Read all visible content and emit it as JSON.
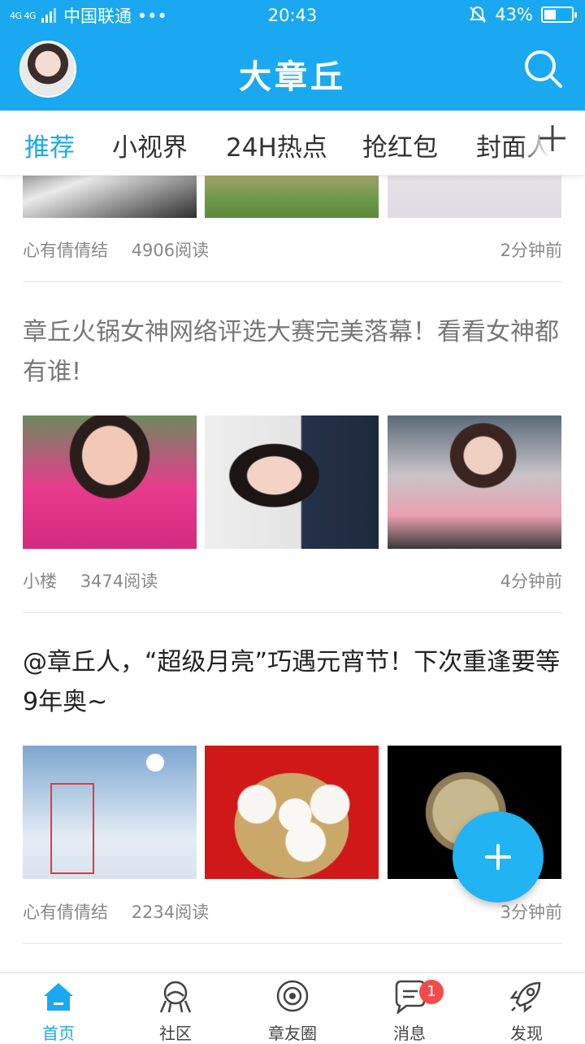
{
  "status_bar": {
    "network": "4G 4G",
    "carrier": "中国联通 •••",
    "time": "20:43",
    "battery_percent": "43%",
    "battery_level": 0.43
  },
  "header": {
    "title": "大章丘",
    "avatar_icon": "user-avatar",
    "search_icon": "search-icon",
    "accent_color": "#1aa9f0"
  },
  "tabs": [
    "推荐",
    "小视界",
    "24H热点",
    "抢红包",
    "封面人"
  ],
  "feed": {
    "items": [
      {
        "author": "心有倩倩结",
        "reads": "4906阅读",
        "time": "2分钟前"
      },
      {
        "title": "章丘火锅女神网络评选大赛完美落幕！看看女神都有谁!",
        "author": "小楼",
        "reads": "3474阅读",
        "time": "4分钟前"
      },
      {
        "title": "@章丘人，“超级月亮”巧遇元宵节！下次重逢要等9年奥~",
        "author": "心有倩倩结",
        "reads": "2234阅读",
        "time": "3分钟前"
      }
    ]
  },
  "bottom_nav": [
    {
      "label": "首页",
      "icon": "home-icon"
    },
    {
      "label": "社区",
      "icon": "community-icon"
    },
    {
      "label": "章友圈",
      "icon": "friends-circle-icon"
    },
    {
      "label": "消息",
      "icon": "message-icon",
      "badge": "1"
    },
    {
      "label": "发现",
      "icon": "rocket-icon"
    }
  ]
}
